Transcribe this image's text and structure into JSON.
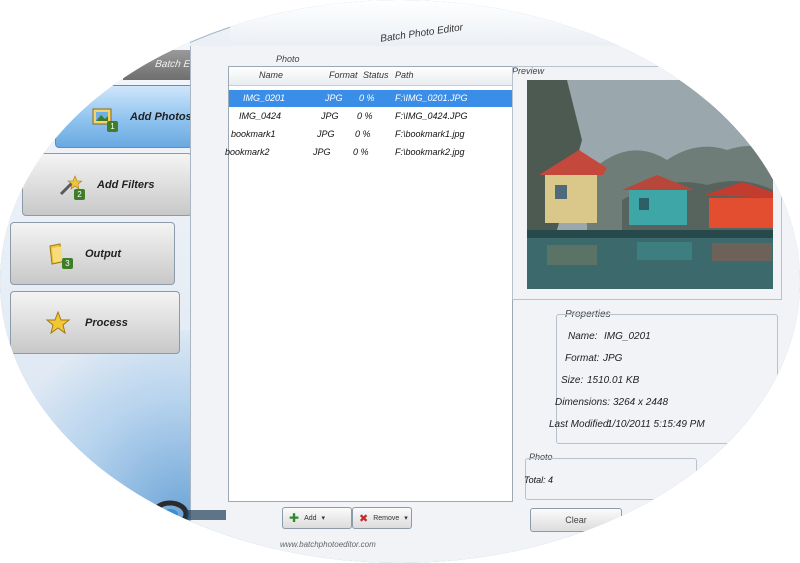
{
  "app": {
    "title": "Batch Photo Editor",
    "header_tab": "Batch Editor"
  },
  "nav": [
    {
      "label": "Add Photos",
      "step": "1",
      "icon": "photos-icon",
      "active": true
    },
    {
      "label": "Add Filters",
      "step": "2",
      "icon": "wand-icon",
      "active": false
    },
    {
      "label": "Output",
      "step": "3",
      "icon": "folder-icon",
      "active": false
    },
    {
      "label": "Process",
      "step": "",
      "icon": "star-icon",
      "active": false
    }
  ],
  "files": {
    "group_label": "Photo",
    "columns": {
      "name": "Name",
      "format": "Format",
      "status": "Status",
      "path": "Path"
    },
    "rows": [
      {
        "name": "IMG_0201",
        "format": "JPG",
        "status": "0 %",
        "path": "F:\\IMG_0201.JPG",
        "selected": true
      },
      {
        "name": "IMG_0424",
        "format": "JPG",
        "status": "0 %",
        "path": "F:\\IMG_0424.JPG",
        "selected": false
      },
      {
        "name": "bookmark1",
        "format": "JPG",
        "status": "0 %",
        "path": "F:\\bookmark1.jpg",
        "selected": false
      },
      {
        "name": "bookmark2",
        "format": "JPG",
        "status": "0 %",
        "path": "F:\\bookmark2.jpg",
        "selected": false
      }
    ]
  },
  "preview": {
    "label": "Preview"
  },
  "properties": {
    "title": "Properties",
    "name_label": "Name:",
    "name_value": "IMG_0201",
    "format_label": "Format:",
    "format_value": "JPG",
    "size_label": "Size:",
    "size_value": "1510.01 KB",
    "dimensions_label": "Dimensions:",
    "dimensions_value": "3264 x 2448",
    "modified_label": "Last Modified:",
    "modified_value": "1/10/2011 5:15:49 PM"
  },
  "photo_group": {
    "title": "Photo",
    "total_label": "Total:",
    "total_value": "4"
  },
  "toolbar": {
    "add_label": "Add",
    "remove_label": "Remove",
    "action_label": "Clear"
  },
  "status": {
    "text": "www.batchphotoeditor.com"
  },
  "colors": {
    "selection": "#3b8ee8",
    "active_nav": "#8fc3ef",
    "badge": "#3f7d28"
  }
}
